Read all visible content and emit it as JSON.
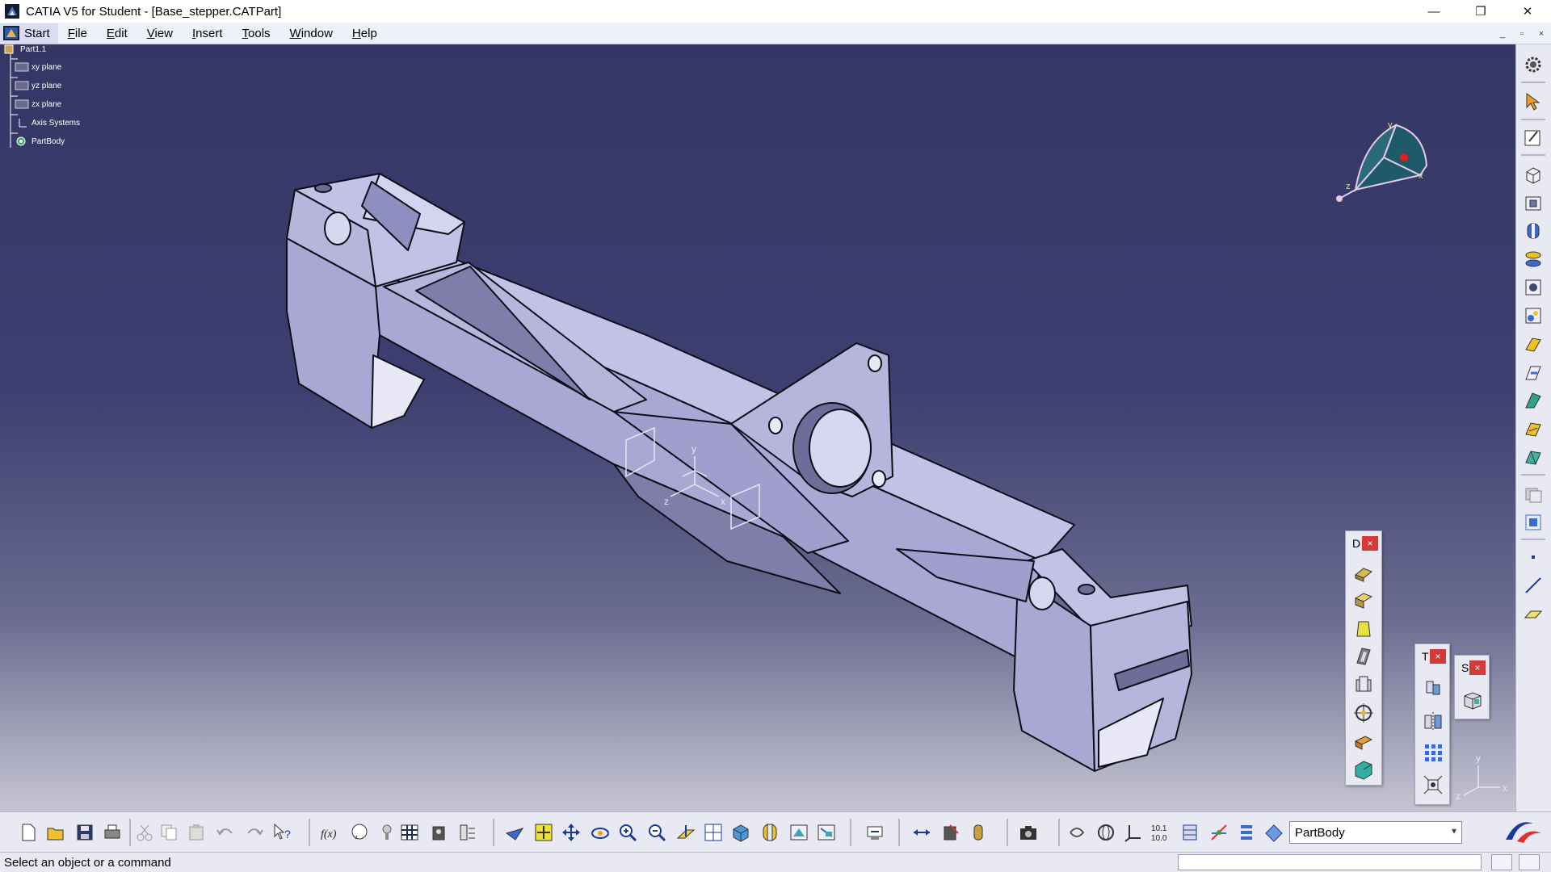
{
  "window": {
    "title": "CATIA V5 for Student - [Base_stepper.CATPart]",
    "controls": {
      "minimize": "—",
      "restore": "❐",
      "close": "✕"
    }
  },
  "menubar": {
    "start": "Start",
    "items": [
      {
        "label": "File",
        "underline": "F",
        "rest": "ile"
      },
      {
        "label": "Edit",
        "underline": "E",
        "rest": "dit"
      },
      {
        "label": "View",
        "underline": "V",
        "rest": "iew"
      },
      {
        "label": "Insert",
        "underline": "I",
        "rest": "nsert"
      },
      {
        "label": "Tools",
        "underline": "T",
        "rest": "ools"
      },
      {
        "label": "Window",
        "underline": "W",
        "rest": "indow"
      },
      {
        "label": "Help",
        "underline": "H",
        "rest": "elp"
      }
    ],
    "doc_controls": {
      "minimize": "_",
      "restore": "▫",
      "close": "×"
    }
  },
  "tree": {
    "root": "Part1.1",
    "nodes": [
      "xy plane",
      "yz plane",
      "zx plane",
      "Axis Systems",
      "PartBody"
    ]
  },
  "model_axis": {
    "x": "x",
    "y": "y",
    "z": "z"
  },
  "compass": {
    "x": "x",
    "y": "y",
    "z": "z"
  },
  "corner_axis": {
    "x": "x",
    "y": "y",
    "z": "z"
  },
  "palettes": {
    "left": {
      "label": "D",
      "close": "×"
    },
    "middle": {
      "label": "T",
      "close": "×"
    },
    "right": {
      "label": "S",
      "close": "×"
    }
  },
  "toolbar": {
    "current_body": "PartBody"
  },
  "status": {
    "message": "Select an object or a command"
  },
  "colors": {
    "part_face": "#a9a8d4",
    "part_face_light": "#c3c2e6",
    "part_face_dark": "#7f7eaa",
    "part_edge": "#0d0d18",
    "viewport_top": "#343765",
    "viewport_bottom": "#c6c5d4",
    "menubar": "#eef0fa",
    "toolbar": "#e8e9f2",
    "close_red": "#d43a3a"
  }
}
